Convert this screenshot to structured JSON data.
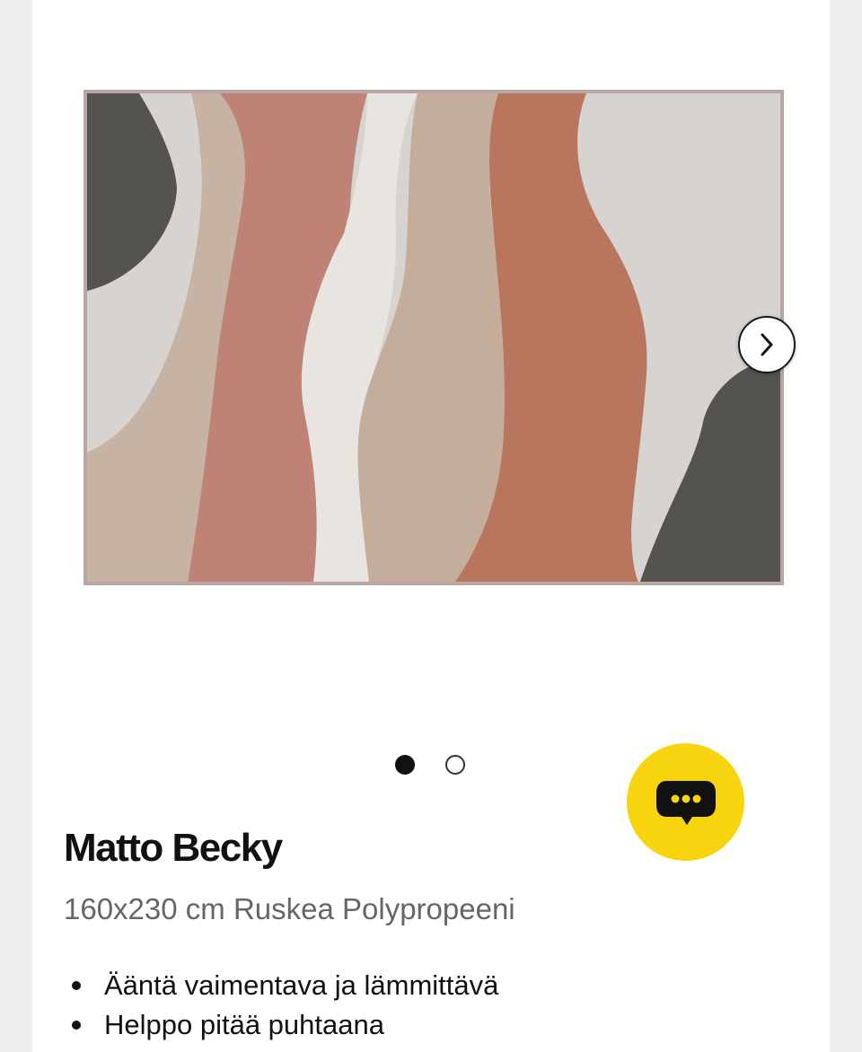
{
  "product": {
    "name": "Matto Becky",
    "description": "160x230 cm Ruskea Polypropeeni",
    "features": [
      "Ääntä vaimentava ja lämmittävä",
      "Helppo pitää puhtaana"
    ]
  },
  "gallery": {
    "image_count": 2,
    "active_index": 1,
    "next_icon": "chevron-right-icon",
    "rug_colors": {
      "border": "#b8a7a0",
      "charcoal": "#55534f",
      "light_grey": "#d6d3d1",
      "beige": "#c7b3a3",
      "rose": "#bf8277",
      "cream": "#e8e4df",
      "taupe": "#c4ad9b",
      "terracotta": "#b9765f"
    }
  },
  "chat": {
    "icon": "chat-bubble-icon",
    "color": "#f8d40e"
  }
}
